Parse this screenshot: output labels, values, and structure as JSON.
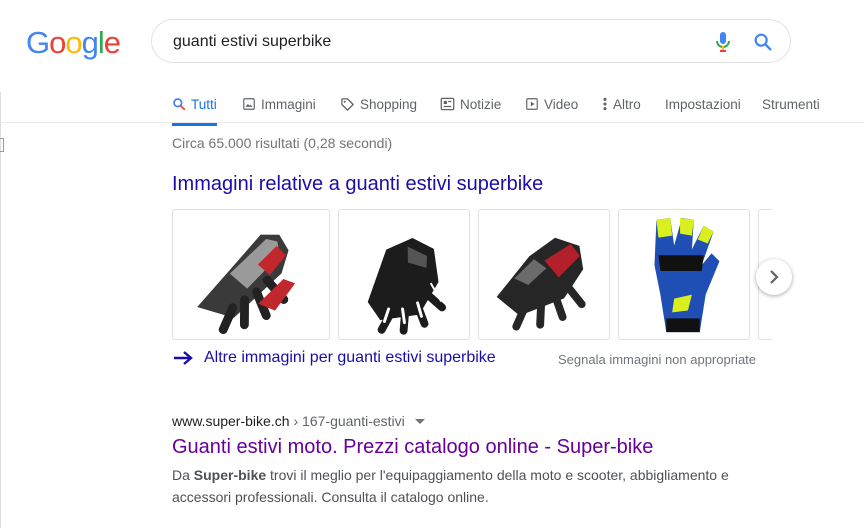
{
  "logo": {
    "letters": [
      "G",
      "o",
      "o",
      "g",
      "l",
      "e"
    ],
    "colors": [
      "#4285F4",
      "#EA4335",
      "#FBBC05",
      "#4285F4",
      "#34A853",
      "#EA4335"
    ]
  },
  "search": {
    "query": "guanti estivi superbike"
  },
  "tabs": [
    {
      "label": "Tutti",
      "icon": "search-icon",
      "active": true
    },
    {
      "label": "Immagini",
      "icon": "image-icon"
    },
    {
      "label": "Shopping",
      "icon": "tag-icon"
    },
    {
      "label": "Notizie",
      "icon": "news-icon"
    },
    {
      "label": "Video",
      "icon": "play-icon"
    },
    {
      "label": "Altro",
      "icon": "more-vert-icon"
    },
    {
      "label": "Impostazioni"
    },
    {
      "label": "Strumenti"
    }
  ],
  "result_stats": "Circa 65.000 risultati (0,28 secondi)",
  "images_section": {
    "heading": "Immagini relative a guanti estivi superbike",
    "thumbnails": [
      {
        "name": "glove-red-grey",
        "colors": [
          "#2a2a2a",
          "#c0282e",
          "#9a9a9a"
        ]
      },
      {
        "name": "glove-black-white",
        "colors": [
          "#1c1c1c",
          "#ffffff",
          "#555555"
        ]
      },
      {
        "name": "glove-black-red",
        "colors": [
          "#262626",
          "#b3202a",
          "#6b6b6b"
        ]
      },
      {
        "name": "glove-blue-yellow",
        "colors": [
          "#1f4fb4",
          "#d9f01e",
          "#111111"
        ]
      }
    ],
    "more_link": "Altre immagini per guanti estivi superbike",
    "report_link": "Segnala immagini non appropriate"
  },
  "result": {
    "cite_domain": "www.super-bike.ch",
    "cite_path": " › 167-guanti-estivi",
    "title": "Guanti estivi moto. Prezzi catalogo online - Super-bike",
    "snippet_prefix": "Da ",
    "snippet_bold": "Super-bike",
    "snippet_rest": " trovi il meglio per l'equipaggiamento della moto e scooter, abbigliamento e accessori professionali. Consulta il catalogo online."
  },
  "colors": {
    "link": "#1a0dab",
    "visited": "#660099",
    "accent": "#1a73e8",
    "muted": "#70757a"
  }
}
